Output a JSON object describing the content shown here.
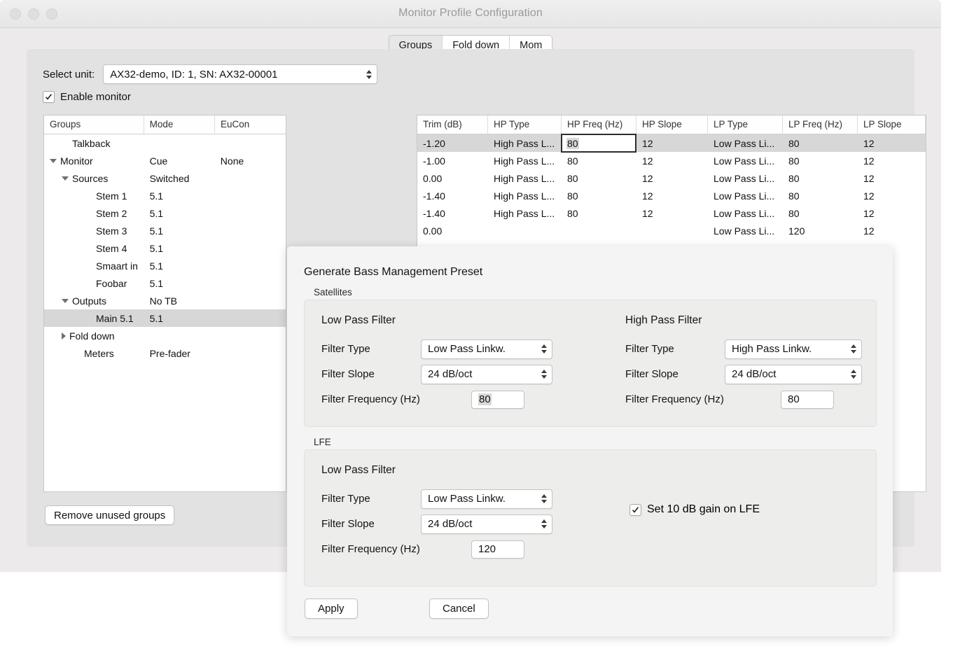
{
  "window": {
    "title": "Monitor Profile Configuration",
    "traffic_lights": [
      "close-button",
      "minimize-button",
      "zoom-button"
    ]
  },
  "tabs": [
    {
      "label": "Groups",
      "active": true
    },
    {
      "label": "Fold down",
      "active": false
    },
    {
      "label": "Mom",
      "active": false
    }
  ],
  "unit": {
    "label": "Select unit:",
    "value": "AX32-demo, ID: 1, SN: AX32-00001"
  },
  "enable_monitor": {
    "label": "Enable monitor",
    "checked": true
  },
  "tree": {
    "headers": [
      "Groups",
      "Mode",
      "EuCon"
    ],
    "rows": [
      {
        "name": "Talkback",
        "mode": "",
        "eucon": "",
        "indent": 1,
        "marker": "none"
      },
      {
        "name": "Monitor",
        "mode": "Cue",
        "eucon": "None",
        "indent": 0,
        "marker": "down"
      },
      {
        "name": "Sources",
        "mode": "Switched",
        "eucon": "",
        "indent": 1,
        "marker": "down"
      },
      {
        "name": "Stem 1",
        "mode": "5.1",
        "eucon": "",
        "indent": 3,
        "marker": "none"
      },
      {
        "name": "Stem 2",
        "mode": "5.1",
        "eucon": "",
        "indent": 3,
        "marker": "none"
      },
      {
        "name": "Stem 3",
        "mode": "5.1",
        "eucon": "",
        "indent": 3,
        "marker": "none"
      },
      {
        "name": "Stem 4",
        "mode": "5.1",
        "eucon": "",
        "indent": 3,
        "marker": "none"
      },
      {
        "name": "Smaart in",
        "mode": "5.1",
        "eucon": "",
        "indent": 3,
        "marker": "none"
      },
      {
        "name": "Foobar",
        "mode": "5.1",
        "eucon": "",
        "indent": 3,
        "marker": "none"
      },
      {
        "name": "Outputs",
        "mode": "No TB",
        "eucon": "",
        "indent": 1,
        "marker": "down"
      },
      {
        "name": "Main 5.1",
        "mode": "5.1",
        "eucon": "",
        "indent": 3,
        "marker": "none",
        "selected": true
      },
      {
        "name": "Fold down",
        "mode": "",
        "eucon": "",
        "indent": 1,
        "marker": "right"
      },
      {
        "name": "Meters",
        "mode": "Pre-fader",
        "eucon": "",
        "indent": 2,
        "marker": "none"
      }
    ],
    "remove_button": "Remove unused groups"
  },
  "table": {
    "headers": [
      "Trim (dB)",
      "HP Type",
      "HP Freq (Hz)",
      "HP Slope",
      "LP Type",
      "LP Freq (Hz)",
      "LP Slope"
    ],
    "rows": [
      {
        "trim": "-1.20",
        "hp_type": "High Pass L...",
        "hp_freq": "80",
        "hp_slope": "12",
        "lp_type": "Low Pass Li...",
        "lp_freq": "80",
        "lp_slope": "12",
        "selected": true,
        "editing": true
      },
      {
        "trim": "-1.00",
        "hp_type": "High Pass L...",
        "hp_freq": "80",
        "hp_slope": "12",
        "lp_type": "Low Pass Li...",
        "lp_freq": "80",
        "lp_slope": "12"
      },
      {
        "trim": "0.00",
        "hp_type": "High Pass L...",
        "hp_freq": "80",
        "hp_slope": "12",
        "lp_type": "Low Pass Li...",
        "lp_freq": "80",
        "lp_slope": "12"
      },
      {
        "trim": "-1.40",
        "hp_type": "High Pass L...",
        "hp_freq": "80",
        "hp_slope": "12",
        "lp_type": "Low Pass Li...",
        "lp_freq": "80",
        "lp_slope": "12"
      },
      {
        "trim": "-1.40",
        "hp_type": "High Pass L...",
        "hp_freq": "80",
        "hp_slope": "12",
        "lp_type": "Low Pass Li...",
        "lp_freq": "80",
        "lp_slope": "12"
      },
      {
        "trim": "0.00",
        "hp_type": "",
        "hp_freq": "",
        "hp_slope": "",
        "lp_type": "Low Pass Li...",
        "lp_freq": "120",
        "lp_slope": "12"
      }
    ]
  },
  "dialog": {
    "title": "Generate Bass Management Preset",
    "satellites": {
      "legend": "Satellites",
      "low_pass": {
        "heading": "Low Pass Filter",
        "type_label": "Filter Type",
        "type_value": "Low Pass Linkw.",
        "slope_label": "Filter Slope",
        "slope_value": "24 dB/oct",
        "freq_label": "Filter Frequency (Hz)",
        "freq_value": "80"
      },
      "high_pass": {
        "heading": "High Pass Filter",
        "type_label": "Filter Type",
        "type_value": "High Pass Linkw.",
        "slope_label": "Filter Slope",
        "slope_value": "24 dB/oct",
        "freq_label": "Filter Frequency (Hz)",
        "freq_value": "80"
      }
    },
    "lfe": {
      "legend": "LFE",
      "low_pass": {
        "heading": "Low Pass Filter",
        "type_label": "Filter Type",
        "type_value": "Low Pass Linkw.",
        "slope_label": "Filter Slope",
        "slope_value": "24 dB/oct",
        "freq_label": "Filter Frequency (Hz)",
        "freq_value": "120"
      },
      "gain_checkbox": {
        "label": "Set 10 dB gain on LFE",
        "checked": true
      }
    },
    "buttons": {
      "apply": "Apply",
      "cancel": "Cancel"
    }
  },
  "colors": {
    "window_bg": "#eceaea",
    "panel_bg": "#e3e2e2",
    "dialog_bg": "#f5f4f4",
    "group_bg": "#ededec",
    "selection": "#d8d7d7",
    "title_text": "#9a9a9a",
    "body_text": "#121212"
  }
}
